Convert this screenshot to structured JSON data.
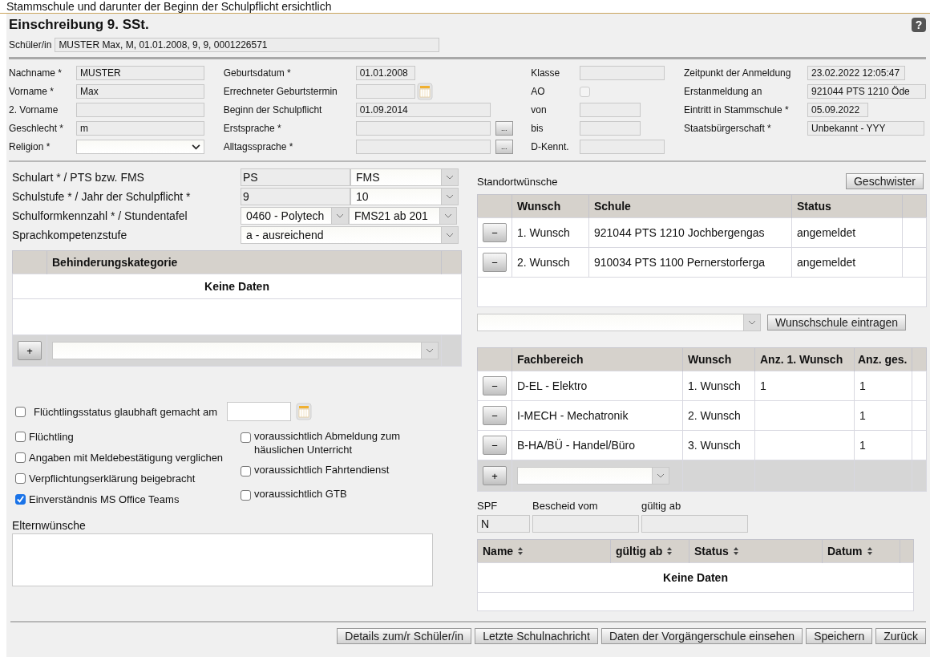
{
  "caption": "Stammschule und darunter der Beginn der Schulpflicht ersichtlich",
  "title": "Einschreibung 9. SSt.",
  "help": "?",
  "student": {
    "label": "Schüler/in",
    "value": "MUSTER Max, M, 01.01.2008, 9, 9, 0001226571"
  },
  "personal": {
    "columns": [
      [
        {
          "label": "Nachname *",
          "kind": "text",
          "value": "MUSTER"
        },
        {
          "label": "Vorname *",
          "kind": "text",
          "value": "Max"
        },
        {
          "label": "2. Vorname",
          "kind": "text"
        },
        {
          "label": "Geschlecht *",
          "kind": "text",
          "value": "m"
        },
        {
          "label": "Religion *",
          "kind": "select"
        }
      ],
      [
        {
          "label": "Geburtsdatum *",
          "kind": "text",
          "value": "01.01.2008"
        },
        {
          "label": "Errechneter Geburtstermin",
          "kind": "date"
        },
        {
          "label": "Beginn der Schulpflicht",
          "kind": "text",
          "value": "01.09.2014"
        },
        {
          "label": "Erstsprache *",
          "kind": "picker",
          "button": "..."
        },
        {
          "label": "Alltagssprache *",
          "kind": "picker",
          "button": "..."
        }
      ],
      [
        {
          "label": "Klasse",
          "kind": "text"
        },
        {
          "label": "AO",
          "kind": "checkbox",
          "checked": false
        },
        {
          "label": "von",
          "kind": "text"
        },
        {
          "label": "bis",
          "kind": "text"
        },
        {
          "label": "D-Kennt.",
          "kind": "text"
        }
      ],
      [
        {
          "label": "Zeitpunkt der Anmeldung",
          "kind": "text",
          "value": "23.02.2022 12:05:47"
        },
        {
          "label": "Erstanmeldung an",
          "kind": "text",
          "value": "921044 PTS 1210 Öde"
        },
        {
          "label": "Eintritt in Stammschule *",
          "kind": "text",
          "value": "05.09.2022"
        },
        {
          "label": "Staatsbürgerschaft *",
          "kind": "text",
          "value": "Unbekannt - YYY"
        }
      ]
    ]
  },
  "school": [
    {
      "label": "Schulart * / PTS bzw. FMS",
      "fields": [
        {
          "kind": "text",
          "value": "PS"
        },
        {
          "kind": "select",
          "value": "FMS"
        }
      ]
    },
    {
      "label": "Schulstufe * / Jahr der Schulpflicht *",
      "fields": [
        {
          "kind": "text",
          "value": "9"
        },
        {
          "kind": "select",
          "value": "10"
        }
      ]
    },
    {
      "label": "Schulformkennzahl * / Stundentafel",
      "fields": [
        {
          "kind": "select",
          "value": "0460 - Polytech"
        },
        {
          "kind": "select",
          "value": "FMS21 ab 201"
        }
      ]
    },
    {
      "label": "Sprachkompetenzstufe",
      "fields": [
        {
          "kind": "select",
          "value": "a - ausreichend"
        }
      ]
    }
  ],
  "disability_table": {
    "columns": [
      "Behinderungskategorie"
    ],
    "empty": "Keine Daten",
    "add_button": "+"
  },
  "options": {
    "left": [
      {
        "kind": "date",
        "label": "Flüchtlingsstatus glaubhaft gemacht am",
        "checked": false
      },
      {
        "kind": "plain",
        "label": "Flüchtling",
        "checked": false
      },
      {
        "kind": "plain",
        "label": "Angaben mit Meldebestätigung verglichen",
        "checked": false
      },
      {
        "kind": "plain",
        "label": "Verpflichtungserklärung beigebracht",
        "checked": false
      },
      {
        "kind": "plain",
        "label": "Einverständnis MS Office Teams",
        "checked": true
      }
    ],
    "right": [
      {
        "kind": "plain",
        "label": "voraussichtlich Abmeldung zum häuslichen Unterricht",
        "checked": false
      },
      {
        "kind": "plain",
        "label": "voraussichtlich Fahrtendienst",
        "checked": false
      },
      {
        "kind": "plain",
        "label": "voraussichtlich GTB",
        "checked": false
      }
    ]
  },
  "parent_wishes": {
    "label": "Elternwünsche"
  },
  "location_wishes": {
    "label": "Standortwünsche",
    "sibling_button": "Geschwister",
    "table": {
      "columns": [
        "Wunsch",
        "Schule",
        "Status"
      ],
      "rows": [
        {
          "button": "−",
          "cells": [
            "1. Wunsch",
            "921044 PTS 1210 Jochbergengas",
            "angemeldet"
          ]
        },
        {
          "button": "−",
          "cells": [
            "2. Wunsch",
            "910034 PTS 1100 Pernerstorferga",
            "angemeldet"
          ]
        }
      ]
    },
    "add_button": "Wunschschule eintragen"
  },
  "subject_table": {
    "columns": [
      "Fachbereich",
      "Wunsch",
      "Anz. 1. Wunsch",
      "Anz. ges."
    ],
    "rows": [
      {
        "button": "−",
        "cells": [
          "D-EL - Elektro",
          "1. Wunsch",
          "1",
          "1"
        ]
      },
      {
        "button": "−",
        "cells": [
          "I-MECH - Mechatronik",
          "2. Wunsch",
          "",
          "1"
        ]
      },
      {
        "button": "−",
        "cells": [
          "B-HA/BÜ - Handel/Büro",
          "3. Wunsch",
          "",
          "1"
        ]
      }
    ],
    "add_button": "+"
  },
  "spf": [
    {
      "label": "SPF",
      "value": "N"
    },
    {
      "label": "Bescheid vom"
    },
    {
      "label": "gültig ab"
    }
  ],
  "spf_table": {
    "columns": [
      {
        "label": "Name",
        "sortable": true
      },
      {
        "label": "gültig ab",
        "sortable": true
      },
      {
        "label": "Status",
        "sortable": true
      },
      {
        "label": "Datum",
        "sortable": true
      }
    ],
    "empty": "Keine Daten"
  },
  "buttons": [
    "Details zum/r Schüler/in",
    "Letzte Schulnachricht",
    "Daten der Vorgängerschule einsehen",
    "Speichern",
    "Zurück"
  ]
}
